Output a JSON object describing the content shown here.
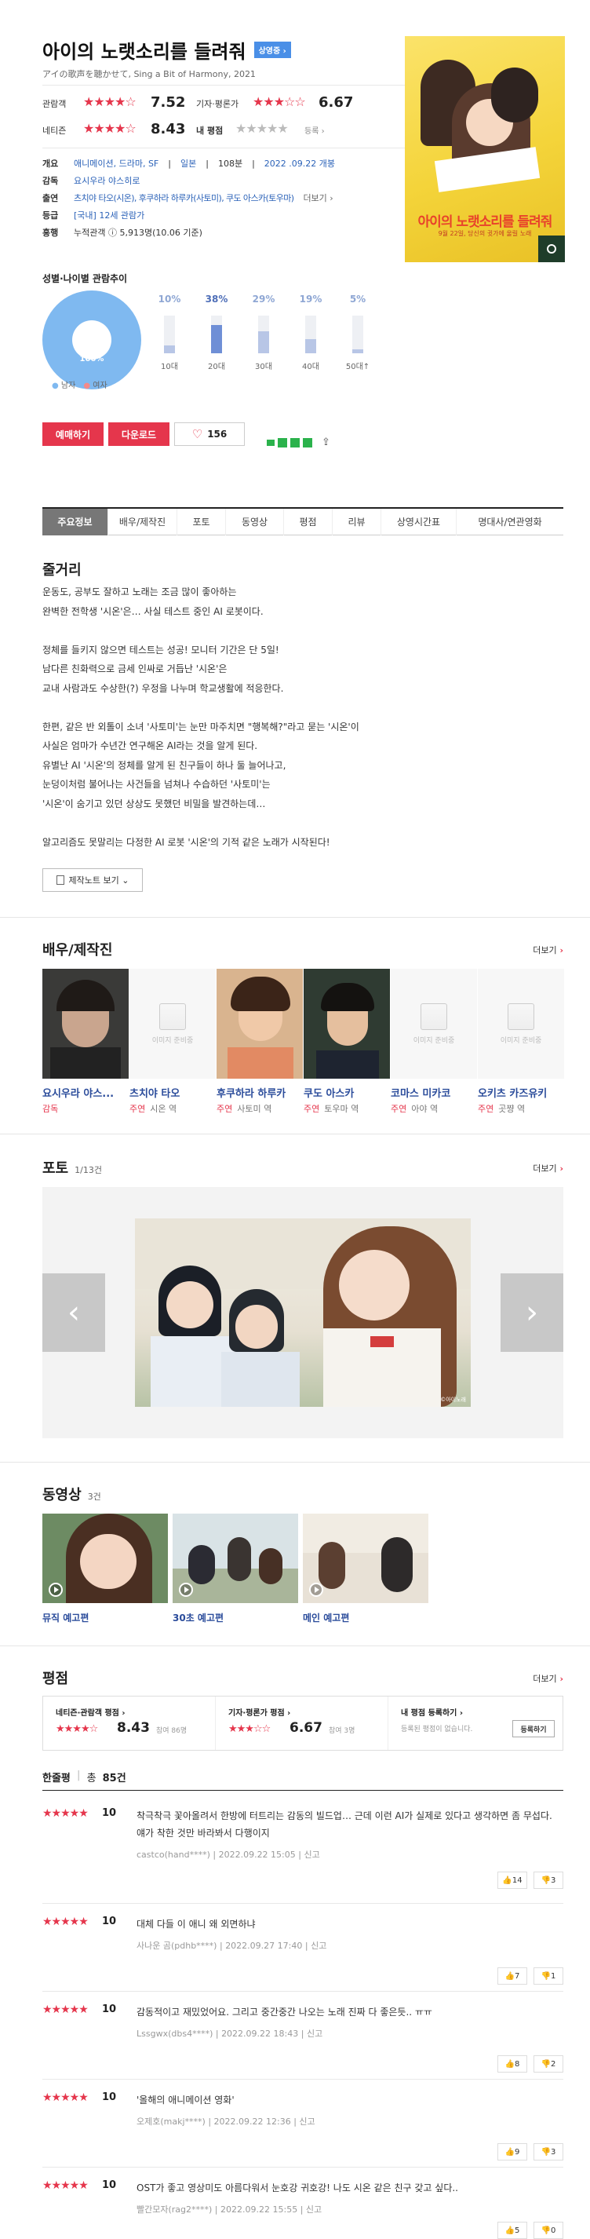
{
  "movie": {
    "title": "아이의 노랫소리를 들려줘",
    "status_badge": "상영중 ›",
    "original_title": "アイの歌声を聴かせて, Sing a Bit of Harmony, 2021",
    "ratings": {
      "audience_label": "관람객",
      "audience_stars": "★★★★☆",
      "audience_score": "7.52",
      "critic_label": "기자·평론가",
      "critic_stars": "★★★☆☆",
      "critic_score": "6.67",
      "netizen_label": "네티즌",
      "netizen_stars": "★★★★☆",
      "netizen_score": "8.43",
      "my_label": "내 평점",
      "my_stars": "★★★★★",
      "my_link": "등록 ›"
    },
    "info": {
      "overview_label": "개요",
      "genre": "애니메이션, 드라마, SF",
      "country": "일본",
      "runtime": "108분",
      "release": "2022 .09.22 개봉",
      "director_label": "감독",
      "director": "요시우라 야스히로",
      "cast_label": "출연",
      "cast": "츠치야 타오(시온), 후쿠하라 하루카(사토미), 쿠도 아스카(토우마)",
      "cast_more": "더보기 ›",
      "grade_label": "등급",
      "grade": "[국내] 12세 관람가",
      "boxoffice_label": "흥행",
      "boxoffice": "누적관객 ⓘ 5,913명(10.06 기준)"
    },
    "poster": {
      "text": "아이의 노랫소리를 들려줘",
      "caption": "9월 22일, 당신의 귓가에 울릴 노래",
      "bg": "#f4d43a"
    }
  },
  "demographics": {
    "title": "성별·나이별 관람추이",
    "pie_label": "100%",
    "legend_male": "남자",
    "legend_female": "여자",
    "age_groups": [
      {
        "age": "10대",
        "pct": "10%",
        "value": 10
      },
      {
        "age": "20대",
        "pct": "38%",
        "value": 38
      },
      {
        "age": "30대",
        "pct": "29%",
        "value": 29
      },
      {
        "age": "40대",
        "pct": "19%",
        "value": 19
      },
      {
        "age": "50대↑",
        "pct": "5%",
        "value": 5
      }
    ]
  },
  "actions": {
    "reserve": "예매하기",
    "download": "다운로드",
    "like_count": "156"
  },
  "tabs": [
    "주요정보",
    "배우/제작진",
    "포토",
    "동영상",
    "평점",
    "리뷰",
    "상영시간표",
    "명대사/연관영화"
  ],
  "synopsis": {
    "title": "줄거리",
    "lines": [
      "운동도, 공부도 잘하고 노래는 조금 많이 좋아하는",
      "완벽한 전학생 '시온'은… 사실 테스트 중인 AI 로봇이다.",
      "",
      "정체를 들키지 않으면 테스트는 성공! 모니터 기간은 단 5일!",
      "남다른 친화력으로 금세 인싸로 거듭난 '시온'은",
      "교내 사람과도 수상한(?) 우정을 나누며 학교생활에 적응한다.",
      "",
      "한편, 같은 반 외톨이 소녀 '사토미'는 눈만 마주치면 \"행복해?\"라고 묻는 '시온'이",
      "사실은 엄마가 수년간 연구해온 AI라는 것을 알게 된다.",
      "유별난 AI '시온'의 정체를 알게 된 친구들이 하나 둘 늘어나고,",
      "눈덩이처럼 불어나는 사건들을 넘쳐나 수습하던 '사토미'는",
      "'시온'이 숨기고 있던 상상도 못했던 비밀을 발견하는데…",
      "",
      "알고리즘도 못말리는 다정한 AI 로봇 '시온'의 기적 같은 노래가 시작된다!"
    ],
    "note_button": "제작노트 보기 ⌄"
  },
  "cast_section": {
    "title": "배우/제작진",
    "more": "더보기",
    "people": [
      {
        "name": "요시우라 야스...",
        "role": "감독",
        "character": ""
      },
      {
        "name": "츠치야 타오",
        "role": "주연",
        "character": "시온 역"
      },
      {
        "name": "후쿠하라 하루카",
        "role": "주연",
        "character": "사토미 역"
      },
      {
        "name": "쿠도 아스카",
        "role": "주연",
        "character": "토우마 역"
      },
      {
        "name": "코마스 미카코",
        "role": "주연",
        "character": "아야 역"
      },
      {
        "name": "오키츠 카즈유키",
        "role": "주연",
        "character": "곳쨩 역"
      }
    ],
    "no_image": "이미지 준비중"
  },
  "photo_section": {
    "title": "포토",
    "count": "1/13건",
    "more": "더보기",
    "copyright": "©아이노래"
  },
  "video_section": {
    "title": "동영상",
    "count": "3건",
    "videos": [
      "뮤직 예고편",
      "30초 예고편",
      "메인 예고편"
    ]
  },
  "rating_section": {
    "title": "평점",
    "more": "더보기",
    "netizen_label": "네티즌·관람객 평점 ›",
    "netizen_stars": "★★★★☆",
    "netizen_score": "8.43",
    "netizen_count": "참여 86명",
    "critic_label": "기자·평론가 평점 ›",
    "critic_stars": "★★★☆☆",
    "critic_score": "6.67",
    "critic_count": "참여 3명",
    "my_label": "내 평점 등록하기 ›",
    "my_desc": "등록된 평점이 없습니다.",
    "my_button": "등록하기",
    "total_label": "한줄평",
    "total_prefix": "총",
    "total_count": "85건"
  },
  "reviews": [
    {
      "stars": "★★★★★",
      "score": "10",
      "text": "착극착극 꽃아올려서 한방에 터트리는 감동의 빌드업… 근데 이런 AI가 실제로 있다고 생각하면 좀 무섭다. 얘가 착한 것만 바라봐서 다행이지",
      "user": "castco(hand****)",
      "date": "2022.09.22 15:05",
      "report": "신고",
      "up": "14",
      "down": "3"
    },
    {
      "stars": "★★★★★",
      "score": "10",
      "text": "대체 다들 이 애니 왜 외면하냐",
      "user": "사나운 곰(pdhb****)",
      "date": "2022.09.27 17:40",
      "report": "신고",
      "up": "7",
      "down": "1"
    },
    {
      "stars": "★★★★★",
      "score": "10",
      "text": "감동적이고 재밌었어요. 그리고 중간중간 나오는 노래 진짜 다 좋은듯.. ㅠㅠ",
      "user": "Lssgwx(dbs4****)",
      "date": "2022.09.22 18:43",
      "report": "신고",
      "up": "8",
      "down": "2"
    },
    {
      "stars": "★★★★★",
      "score": "10",
      "text": "'올해의 애니메이션 영화'",
      "user": "오제호(makj****)",
      "date": "2022.09.22 12:36",
      "report": "신고",
      "up": "9",
      "down": "3"
    },
    {
      "stars": "★★★★★",
      "score": "10",
      "text": "OST가 좋고 영상미도 아름다워서 눈호강 귀호강! 나도 시온 같은 친구 갖고 싶다..",
      "user": "빨간모자(rag2****)",
      "date": "2022.09.22 15:55",
      "report": "신고",
      "up": "5",
      "down": "0"
    }
  ],
  "colors": {
    "accent": "#e5364c",
    "link": "#2b62b8",
    "badge": "#4a8fe7",
    "pie": "#7fb9f0"
  }
}
